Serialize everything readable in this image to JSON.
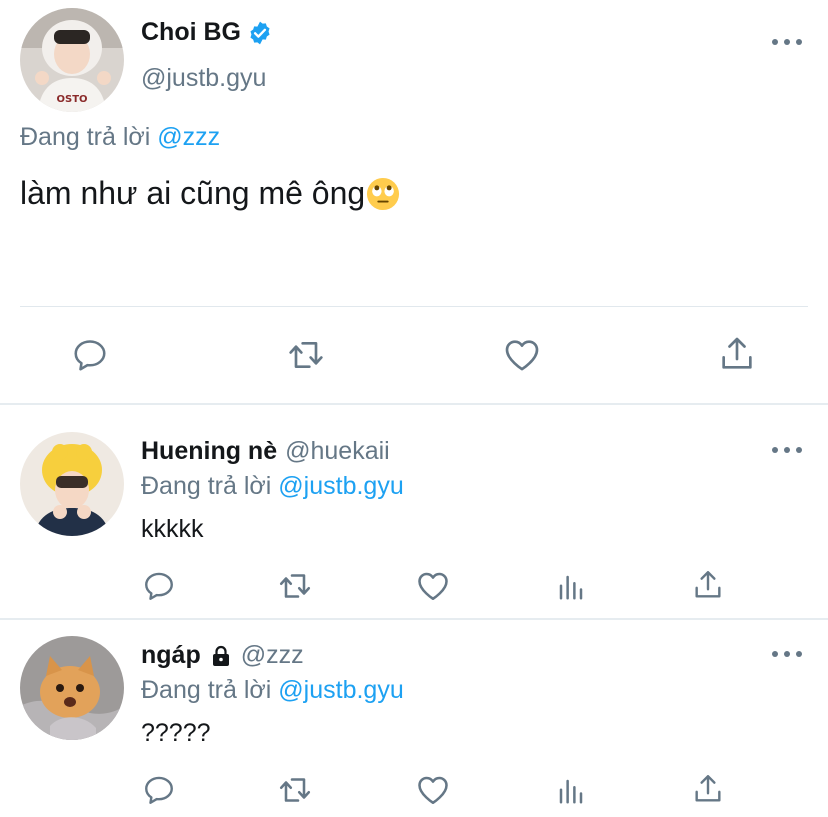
{
  "main_tweet": {
    "display_name": "Choi BG",
    "handle": "@justb.gyu",
    "reply_prefix": "Đang trả lời",
    "reply_to": "@zzz",
    "text": "làm như ai cũng mê ông",
    "emoji": "face-with-rolling-eyes",
    "actions": [
      "reply",
      "retweet",
      "like",
      "share"
    ]
  },
  "replies": [
    {
      "display_name": "Huening nè",
      "handle": "@huekaii",
      "reply_prefix": "Đang trả lời",
      "reply_to": "@justb.gyu",
      "text": "kkkkk",
      "actions": [
        "reply",
        "retweet",
        "like",
        "analytics",
        "share"
      ]
    },
    {
      "display_name": "ngáp",
      "protected": true,
      "handle": "@zzz",
      "reply_prefix": "Đang trả lời",
      "reply_to": "@justb.gyu",
      "text": "?????",
      "actions": [
        "reply",
        "retweet",
        "like",
        "analytics",
        "share"
      ]
    }
  ],
  "colors": {
    "accent": "#1da1f2",
    "secondary_text": "#657786",
    "icon": "#657786",
    "divider": "#e6ecf0"
  }
}
